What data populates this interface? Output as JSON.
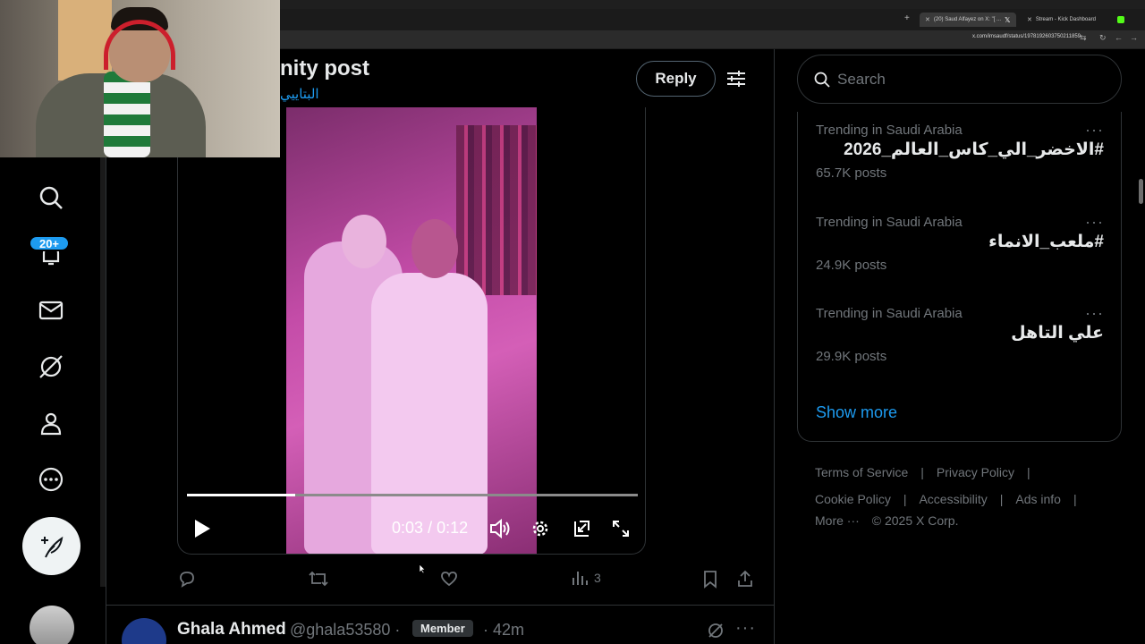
{
  "browser": {
    "tab_active_title": "(20) Saud Alfayez on X: \"[ ...",
    "tab_2_title": "Stream - Kick Dashboard",
    "url": "x.com/imsaudf/status/1978192603750211859"
  },
  "nav": {
    "notifications_badge": "20+"
  },
  "post": {
    "title": "nity post",
    "subtitle": "البتاييي",
    "reply_label": "Reply"
  },
  "video": {
    "time_current": "0:03",
    "time_separator": "/",
    "time_total": "0:12",
    "progress": 0.24
  },
  "actions": {
    "views": "3"
  },
  "next_post": {
    "name": "Ghala Ahmed",
    "handle": "@ghala53580 ·",
    "badge": "Member",
    "time": "· 42m"
  },
  "search": {
    "placeholder": "Search"
  },
  "trends": [
    {
      "category": "Trending in Saudi Arabia",
      "name": "#الاخضر_الي_كاس_العالم_2026",
      "count": "65.7K posts"
    },
    {
      "category": "Trending in Saudi Arabia",
      "name": "#ملعب_الانماء",
      "count": "24.9K posts"
    },
    {
      "category": "Trending in Saudi Arabia",
      "name": "علي التاهل",
      "count": "29.9K posts"
    }
  ],
  "show_more": "Show more",
  "footer": {
    "terms": "Terms of Service",
    "privacy": "Privacy Policy",
    "cookie": "Cookie Policy",
    "accessibility": "Accessibility",
    "ads": "Ads info",
    "more": "More ···",
    "copyright": "© 2025 X Corp."
  },
  "colors": {
    "accent": "#1d9bf0",
    "background": "#000000",
    "muted": "#71767b"
  }
}
